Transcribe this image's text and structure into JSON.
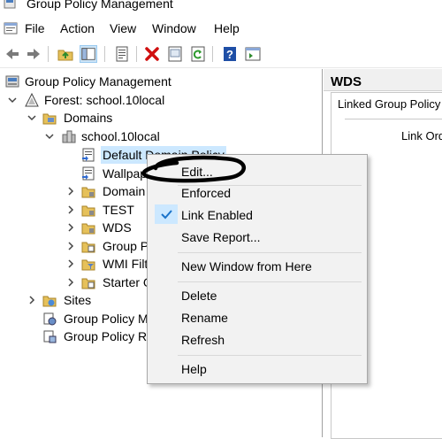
{
  "window": {
    "title": "Group Policy Management"
  },
  "menu": {
    "items": [
      "File",
      "Action",
      "View",
      "Window",
      "Help"
    ]
  },
  "toolbar": {
    "icons": [
      "back-arrow-icon",
      "forward-arrow-icon",
      "up-folder-icon",
      "show-hide-tree-icon",
      "properties-icon",
      "delete-icon",
      "export-list-icon",
      "refresh-icon",
      "help-icon",
      "console-view-icon"
    ]
  },
  "tree": {
    "root": "Group Policy Management",
    "forest": "Forest: school.10local",
    "domains": "Domains",
    "domain": "school.10local",
    "gpos": [
      {
        "label": "Default Domain Policy",
        "selected": true
      },
      {
        "label": "Wallpap"
      }
    ],
    "ous": [
      "Domain",
      "TEST",
      "WDS",
      "Group P",
      "WMI Filt",
      "Starter G"
    ],
    "sites": "Sites",
    "modeling": "Group Policy M",
    "results": "Group Policy Re"
  },
  "right": {
    "title": "WDS",
    "tab": "Linked Group Policy O",
    "column": "Link Ord"
  },
  "context_menu": {
    "edit": "Edit...",
    "enforced": "Enforced",
    "link_enabled": "Link Enabled",
    "link_enabled_checked": true,
    "save_report": "Save Report...",
    "new_window": "New Window from Here",
    "delete": "Delete",
    "rename": "Rename",
    "refresh": "Refresh",
    "help": "Help"
  },
  "colors": {
    "selection": "#cce8ff",
    "menu_bg": "#f2f2f2",
    "check": "#1a73c9"
  }
}
